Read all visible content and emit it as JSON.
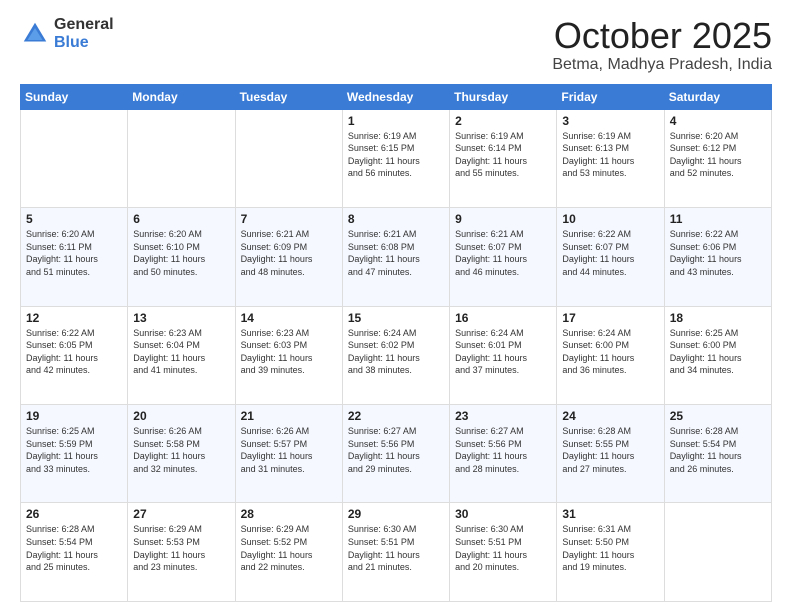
{
  "logo": {
    "general": "General",
    "blue": "Blue"
  },
  "header": {
    "month": "October 2025",
    "location": "Betma, Madhya Pradesh, India"
  },
  "weekdays": [
    "Sunday",
    "Monday",
    "Tuesday",
    "Wednesday",
    "Thursday",
    "Friday",
    "Saturday"
  ],
  "weeks": [
    [
      {
        "day": "",
        "info": ""
      },
      {
        "day": "",
        "info": ""
      },
      {
        "day": "",
        "info": ""
      },
      {
        "day": "1",
        "info": "Sunrise: 6:19 AM\nSunset: 6:15 PM\nDaylight: 11 hours\nand 56 minutes."
      },
      {
        "day": "2",
        "info": "Sunrise: 6:19 AM\nSunset: 6:14 PM\nDaylight: 11 hours\nand 55 minutes."
      },
      {
        "day": "3",
        "info": "Sunrise: 6:19 AM\nSunset: 6:13 PM\nDaylight: 11 hours\nand 53 minutes."
      },
      {
        "day": "4",
        "info": "Sunrise: 6:20 AM\nSunset: 6:12 PM\nDaylight: 11 hours\nand 52 minutes."
      }
    ],
    [
      {
        "day": "5",
        "info": "Sunrise: 6:20 AM\nSunset: 6:11 PM\nDaylight: 11 hours\nand 51 minutes."
      },
      {
        "day": "6",
        "info": "Sunrise: 6:20 AM\nSunset: 6:10 PM\nDaylight: 11 hours\nand 50 minutes."
      },
      {
        "day": "7",
        "info": "Sunrise: 6:21 AM\nSunset: 6:09 PM\nDaylight: 11 hours\nand 48 minutes."
      },
      {
        "day": "8",
        "info": "Sunrise: 6:21 AM\nSunset: 6:08 PM\nDaylight: 11 hours\nand 47 minutes."
      },
      {
        "day": "9",
        "info": "Sunrise: 6:21 AM\nSunset: 6:07 PM\nDaylight: 11 hours\nand 46 minutes."
      },
      {
        "day": "10",
        "info": "Sunrise: 6:22 AM\nSunset: 6:07 PM\nDaylight: 11 hours\nand 44 minutes."
      },
      {
        "day": "11",
        "info": "Sunrise: 6:22 AM\nSunset: 6:06 PM\nDaylight: 11 hours\nand 43 minutes."
      }
    ],
    [
      {
        "day": "12",
        "info": "Sunrise: 6:22 AM\nSunset: 6:05 PM\nDaylight: 11 hours\nand 42 minutes."
      },
      {
        "day": "13",
        "info": "Sunrise: 6:23 AM\nSunset: 6:04 PM\nDaylight: 11 hours\nand 41 minutes."
      },
      {
        "day": "14",
        "info": "Sunrise: 6:23 AM\nSunset: 6:03 PM\nDaylight: 11 hours\nand 39 minutes."
      },
      {
        "day": "15",
        "info": "Sunrise: 6:24 AM\nSunset: 6:02 PM\nDaylight: 11 hours\nand 38 minutes."
      },
      {
        "day": "16",
        "info": "Sunrise: 6:24 AM\nSunset: 6:01 PM\nDaylight: 11 hours\nand 37 minutes."
      },
      {
        "day": "17",
        "info": "Sunrise: 6:24 AM\nSunset: 6:00 PM\nDaylight: 11 hours\nand 36 minutes."
      },
      {
        "day": "18",
        "info": "Sunrise: 6:25 AM\nSunset: 6:00 PM\nDaylight: 11 hours\nand 34 minutes."
      }
    ],
    [
      {
        "day": "19",
        "info": "Sunrise: 6:25 AM\nSunset: 5:59 PM\nDaylight: 11 hours\nand 33 minutes."
      },
      {
        "day": "20",
        "info": "Sunrise: 6:26 AM\nSunset: 5:58 PM\nDaylight: 11 hours\nand 32 minutes."
      },
      {
        "day": "21",
        "info": "Sunrise: 6:26 AM\nSunset: 5:57 PM\nDaylight: 11 hours\nand 31 minutes."
      },
      {
        "day": "22",
        "info": "Sunrise: 6:27 AM\nSunset: 5:56 PM\nDaylight: 11 hours\nand 29 minutes."
      },
      {
        "day": "23",
        "info": "Sunrise: 6:27 AM\nSunset: 5:56 PM\nDaylight: 11 hours\nand 28 minutes."
      },
      {
        "day": "24",
        "info": "Sunrise: 6:28 AM\nSunset: 5:55 PM\nDaylight: 11 hours\nand 27 minutes."
      },
      {
        "day": "25",
        "info": "Sunrise: 6:28 AM\nSunset: 5:54 PM\nDaylight: 11 hours\nand 26 minutes."
      }
    ],
    [
      {
        "day": "26",
        "info": "Sunrise: 6:28 AM\nSunset: 5:54 PM\nDaylight: 11 hours\nand 25 minutes."
      },
      {
        "day": "27",
        "info": "Sunrise: 6:29 AM\nSunset: 5:53 PM\nDaylight: 11 hours\nand 23 minutes."
      },
      {
        "day": "28",
        "info": "Sunrise: 6:29 AM\nSunset: 5:52 PM\nDaylight: 11 hours\nand 22 minutes."
      },
      {
        "day": "29",
        "info": "Sunrise: 6:30 AM\nSunset: 5:51 PM\nDaylight: 11 hours\nand 21 minutes."
      },
      {
        "day": "30",
        "info": "Sunrise: 6:30 AM\nSunset: 5:51 PM\nDaylight: 11 hours\nand 20 minutes."
      },
      {
        "day": "31",
        "info": "Sunrise: 6:31 AM\nSunset: 5:50 PM\nDaylight: 11 hours\nand 19 minutes."
      },
      {
        "day": "",
        "info": ""
      }
    ]
  ]
}
